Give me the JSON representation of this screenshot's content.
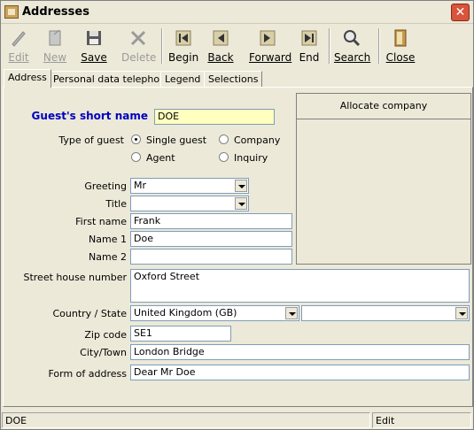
{
  "window": {
    "title": "Addresses",
    "close_glyph": "✕"
  },
  "toolbar": {
    "edit": "Edit",
    "new": "New",
    "save": "Save",
    "delete": "Delete",
    "begin": "Begin",
    "back": "Back",
    "forward": "Forward",
    "end": "End",
    "search": "Search",
    "close": "Close"
  },
  "tabs": [
    "Address",
    "Personal data telephone",
    "Legend",
    "Selections"
  ],
  "form": {
    "short_name_label": "Guest's short name",
    "short_name_value": "DOE",
    "type_label": "Type of guest",
    "types": [
      "Single guest",
      "Company",
      "Agent",
      "Inquiry"
    ],
    "selected_type": "Single guest",
    "greeting_label": "Greeting",
    "greeting_value": "Mr",
    "title_label": "Title",
    "title_value": "",
    "firstname_label": "First name",
    "firstname_value": "Frank",
    "name1_label": "Name 1",
    "name1_value": "Doe",
    "name2_label": "Name 2",
    "name2_value": "",
    "street_label": "Street house number",
    "street_value": "Oxford Street",
    "country_label": "Country / State",
    "country_value": "United Kingdom (GB)",
    "state_value": "",
    "zip_label": "Zip code",
    "zip_value": "SE1",
    "city_label": "City/Town",
    "city_value": "London Bridge",
    "form_label": "Form of address",
    "form_value": "Dear Mr Doe"
  },
  "panel": {
    "header": "Allocate company"
  },
  "status": {
    "left": "DOE",
    "right": "Edit"
  },
  "colors": {
    "accent_label": "#0000c0",
    "highlight_field": "#ffffc0"
  }
}
